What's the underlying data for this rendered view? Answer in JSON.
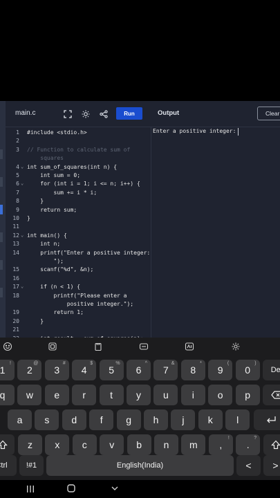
{
  "editor": {
    "file_tab": "main.c",
    "run_label": "Run",
    "output_title": "Output",
    "clear_label": "Clear",
    "lines": [
      {
        "n": "1",
        "text": "#include <stdio.h>",
        "kind": "code"
      },
      {
        "n": "2",
        "text": "",
        "kind": "code"
      },
      {
        "n": "3",
        "text": "// Function to calculate sum of",
        "kind": "cmt"
      },
      {
        "n": "",
        "text": "    squares",
        "kind": "cmt"
      },
      {
        "n": "4",
        "text": "int sum_of_squares(int n) {",
        "kind": "code",
        "fold": true
      },
      {
        "n": "5",
        "text": "    int sum = 0;",
        "kind": "code"
      },
      {
        "n": "6",
        "text": "    for (int i = 1; i <= n; i++) {",
        "kind": "code",
        "fold": true
      },
      {
        "n": "7",
        "text": "        sum += i * i;",
        "kind": "code"
      },
      {
        "n": "8",
        "text": "    }",
        "kind": "code"
      },
      {
        "n": "9",
        "text": "    return sum;",
        "kind": "code"
      },
      {
        "n": "10",
        "text": "}",
        "kind": "code"
      },
      {
        "n": "11",
        "text": "",
        "kind": "code"
      },
      {
        "n": "12",
        "text": "int main() {",
        "kind": "code",
        "fold": true
      },
      {
        "n": "13",
        "text": "    int n;",
        "kind": "code"
      },
      {
        "n": "14",
        "text": "    printf(\"Enter a positive integer:",
        "kind": "code"
      },
      {
        "n": "",
        "text": "        \");",
        "kind": "code"
      },
      {
        "n": "15",
        "text": "    scanf(\"%d\", &n);",
        "kind": "code"
      },
      {
        "n": "16",
        "text": "",
        "kind": "code"
      },
      {
        "n": "17",
        "text": "    if (n < 1) {",
        "kind": "code",
        "fold": true
      },
      {
        "n": "18",
        "text": "        printf(\"Please enter a",
        "kind": "code"
      },
      {
        "n": "",
        "text": "            positive integer.\");",
        "kind": "code"
      },
      {
        "n": "19",
        "text": "        return 1;",
        "kind": "code"
      },
      {
        "n": "20",
        "text": "    }",
        "kind": "code"
      },
      {
        "n": "21",
        "text": "",
        "kind": "code"
      },
      {
        "n": "22",
        "text": "    int result = sum_of_squares(n);",
        "kind": "code"
      }
    ],
    "output_text": "Enter a positive integer: ",
    "icons": [
      "fullscreen-icon",
      "brightness-icon",
      "share-icon"
    ]
  },
  "keyboard": {
    "row_numbers": [
      {
        "label": "1",
        "hint": "!"
      },
      {
        "label": "2",
        "hint": "@"
      },
      {
        "label": "3",
        "hint": "#"
      },
      {
        "label": "4",
        "hint": "$"
      },
      {
        "label": "5",
        "hint": "%"
      },
      {
        "label": "6",
        "hint": "^"
      },
      {
        "label": "7",
        "hint": "&"
      },
      {
        "label": "8",
        "hint": "*"
      },
      {
        "label": "9",
        "hint": "("
      },
      {
        "label": "0",
        "hint": ")"
      }
    ],
    "del_label": "Del",
    "row_q": [
      "q",
      "w",
      "e",
      "r",
      "t",
      "y",
      "u",
      "i",
      "o",
      "p"
    ],
    "row_a": [
      "a",
      "s",
      "d",
      "f",
      "g",
      "h",
      "j",
      "k",
      "l"
    ],
    "row_z": [
      {
        "label": "z",
        "hint": ""
      },
      {
        "label": "x",
        "hint": ""
      },
      {
        "label": "c",
        "hint": ""
      },
      {
        "label": "v",
        "hint": ""
      },
      {
        "label": "b",
        "hint": ""
      },
      {
        "label": "n",
        "hint": ""
      },
      {
        "label": "m",
        "hint": ""
      },
      {
        "label": ",",
        "hint": "!"
      },
      {
        "label": ".",
        "hint": "?"
      }
    ],
    "ctrl_label": "Ctrl",
    "symbols_label": "!#1",
    "space_label": "English(India)",
    "left_arrow": "<",
    "right_arrow": ">",
    "toolbar_icons": [
      "emoji-icon",
      "sticker-icon",
      "clipboard-icon",
      "mode-icon",
      "handwriting-icon",
      "settings-icon"
    ]
  }
}
